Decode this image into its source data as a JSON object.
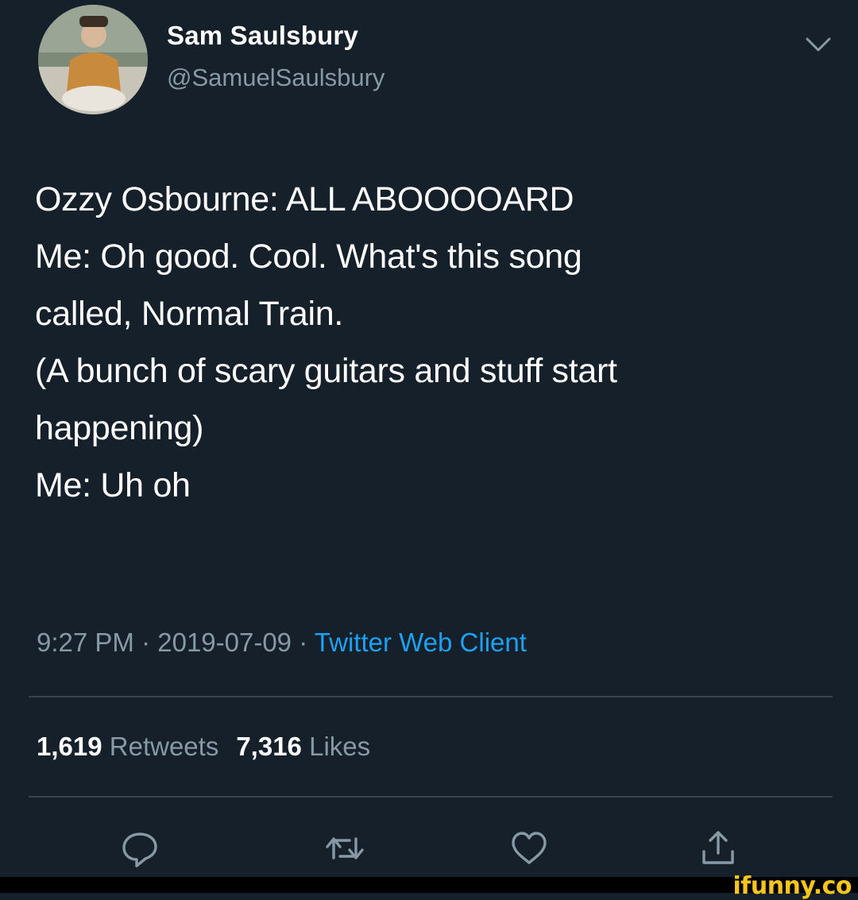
{
  "author": {
    "display_name": "Sam Saulsbury",
    "handle": "@SamuelSaulsbury"
  },
  "tweet": {
    "lines": [
      "Ozzy Osbourne: ALL ABOOOOARD",
      "Me: Oh good. Cool. What's this song",
      "called, Normal Train.",
      "(A bunch of scary guitars and stuff start",
      "happening)",
      "Me: Uh oh"
    ]
  },
  "meta": {
    "time": "9:27 PM",
    "separator": " · ",
    "date": "2019-07-09",
    "client": "Twitter Web Client"
  },
  "stats": {
    "retweets_count": "1,619",
    "retweets_label": "Retweets",
    "likes_count": "7,316",
    "likes_label": "Likes"
  },
  "actions": [
    "reply-icon",
    "retweet-icon",
    "like-icon",
    "share-icon"
  ],
  "watermark": "ifunny.co",
  "colors": {
    "background": "#15202b",
    "secondary_text": "#8899a6",
    "link": "#1da1f2",
    "divider": "#38444d"
  }
}
